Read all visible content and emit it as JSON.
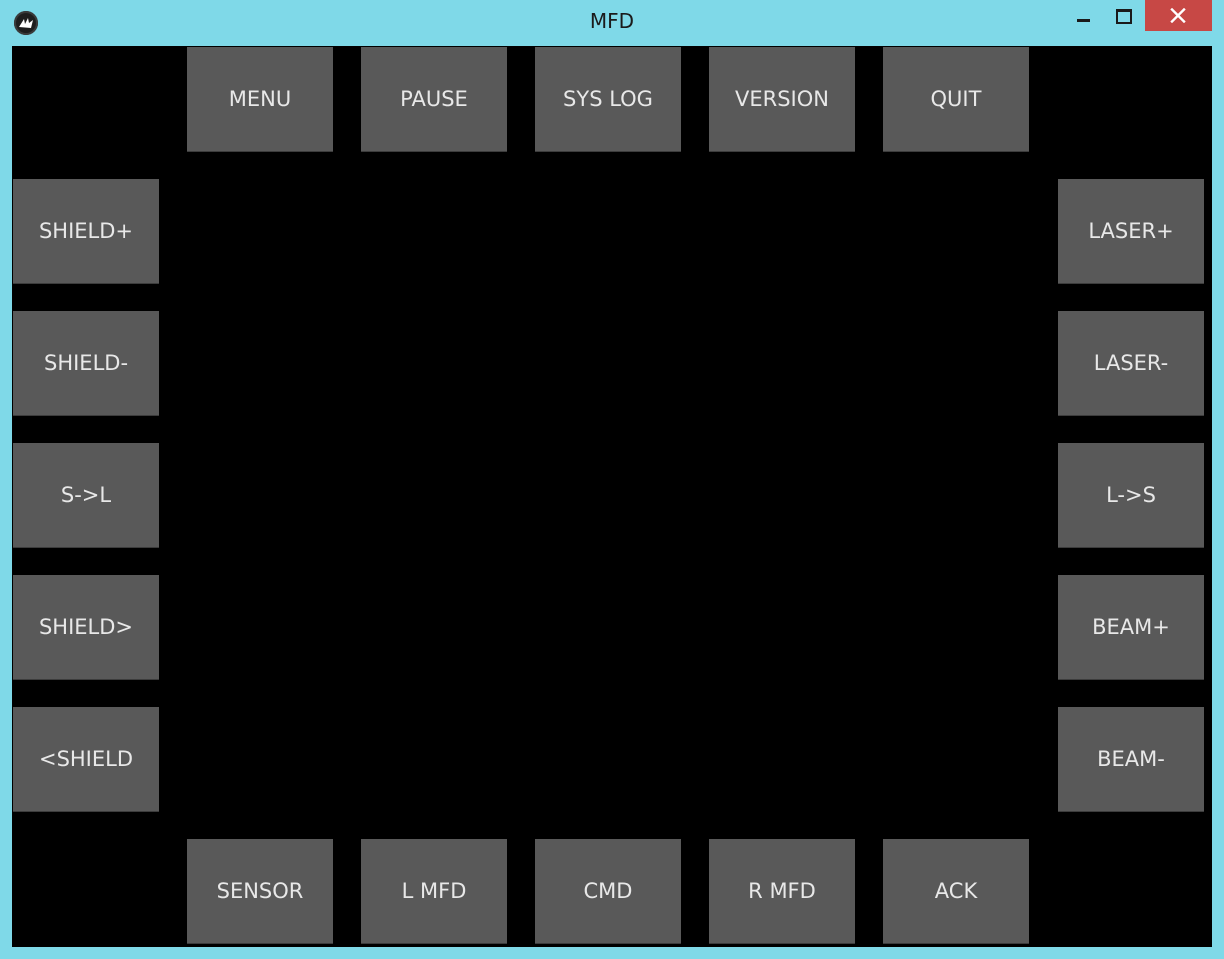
{
  "window": {
    "title": "MFD"
  },
  "top_row": [
    "MENU",
    "PAUSE",
    "SYS LOG",
    "VERSION",
    "QUIT"
  ],
  "left_column": [
    "SHIELD+",
    "SHIELD-",
    "S->L",
    "SHIELD>",
    "<SHIELD"
  ],
  "right_column": [
    "LASER+",
    "LASER-",
    "L->S",
    "BEAM+",
    "BEAM-"
  ],
  "bottom_row": [
    "SENSOR",
    "L MFD",
    "CMD",
    "R MFD",
    "ACK"
  ],
  "colors": {
    "titlebar": "#7fd9e8",
    "surface": "#000000",
    "button": "#595959",
    "button_text": "#e8e8e8",
    "close_button": "#c74845"
  },
  "icons": {
    "app": "kivy-logo-icon",
    "minimize": "minimize-icon",
    "maximize": "maximize-icon",
    "close": "close-icon"
  }
}
